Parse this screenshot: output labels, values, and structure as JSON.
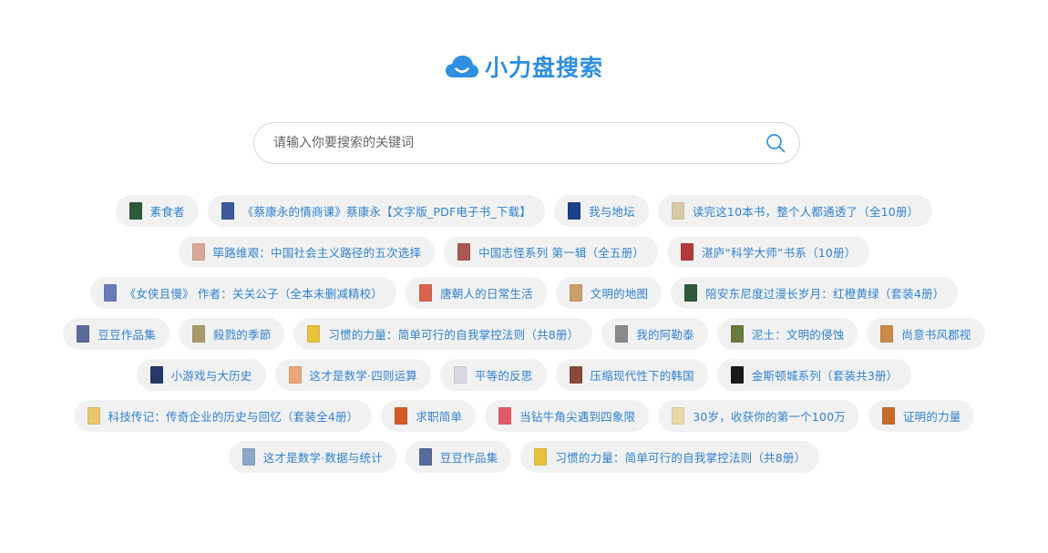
{
  "brand": {
    "title": "小力盘搜索",
    "logo_icon": "cloud-smile-icon",
    "accent_color": "#2f8fe0"
  },
  "search": {
    "placeholder": "请输入你要搜索的关键词",
    "value": "",
    "button_icon": "search-icon"
  },
  "tags": [
    {
      "label": "素食者",
      "cover_color": "#2d5a3d"
    },
    {
      "label": "《蔡康永的情商课》蔡康永【文字版_PDF电子书_下载】",
      "cover_color": "#3a5a9a"
    },
    {
      "label": "我与地坛",
      "cover_color": "#1e3f8a"
    },
    {
      "label": "读完这10本书，整个人都通透了（全10册）",
      "cover_color": "#d9c9a6"
    },
    {
      "label": "筚路维艰：中国社会主义路径的五次选择",
      "cover_color": "#d6a896"
    },
    {
      "label": "中国志怪系列 第一辑（全五册）",
      "cover_color": "#a85a52"
    },
    {
      "label": "湛庐“科学大师”书系（10册）",
      "cover_color": "#b23a3a"
    },
    {
      "label": "《女侠且慢》 作者：关关公子（全本未删减精校）",
      "cover_color": "#6a7ab8"
    },
    {
      "label": "唐朝人的日常生活",
      "cover_color": "#d8644a"
    },
    {
      "label": "文明的地图",
      "cover_color": "#c9a06a"
    },
    {
      "label": "陪安东尼度过漫长岁月：红橙黄绿（套装4册）",
      "cover_color": "#2e5a3a"
    },
    {
      "label": "豆豆作品集",
      "cover_color": "#5a6a9a"
    },
    {
      "label": "殺戮的季節",
      "cover_color": "#a89a6a"
    },
    {
      "label": "习惯的力量：简单可行的自我掌控法则（共8册）",
      "cover_color": "#e8c23a"
    },
    {
      "label": "我的阿勒泰",
      "cover_color": "#8a8a8a"
    },
    {
      "label": "泥土：文明的侵蚀",
      "cover_color": "#6a7a3a"
    },
    {
      "label": "尚意书风郡视",
      "cover_color": "#c98a4a"
    },
    {
      "label": "小游戏与大历史",
      "cover_color": "#24386a"
    },
    {
      "label": "这才是数学·四则运算",
      "cover_color": "#e8a87a"
    },
    {
      "label": "平等的反思",
      "cover_color": "#d8d8e0"
    },
    {
      "label": "压缩现代性下的韩国",
      "cover_color": "#8a4a3a"
    },
    {
      "label": "金斯顿城系列（套装共3册）",
      "cover_color": "#1a1a1a"
    },
    {
      "label": "科技传记：传奇企业的历史与回忆（套装全4册）",
      "cover_color": "#e8c66a"
    },
    {
      "label": "求职简单",
      "cover_color": "#d8582a"
    },
    {
      "label": "当钻牛角尖遇到四象限",
      "cover_color": "#e25a6a"
    },
    {
      "label": "30岁，收获你的第一个100万",
      "cover_color": "#e8d8a8"
    },
    {
      "label": "证明的力量",
      "cover_color": "#c86a2a"
    },
    {
      "label": "这才是数学·数据与统计",
      "cover_color": "#8aa8c8"
    },
    {
      "label": "豆豆作品集",
      "cover_color": "#5a6a9a"
    },
    {
      "label": "习惯的力量：简单可行的自我掌控法则（共8册）",
      "cover_color": "#e8c23a"
    }
  ]
}
